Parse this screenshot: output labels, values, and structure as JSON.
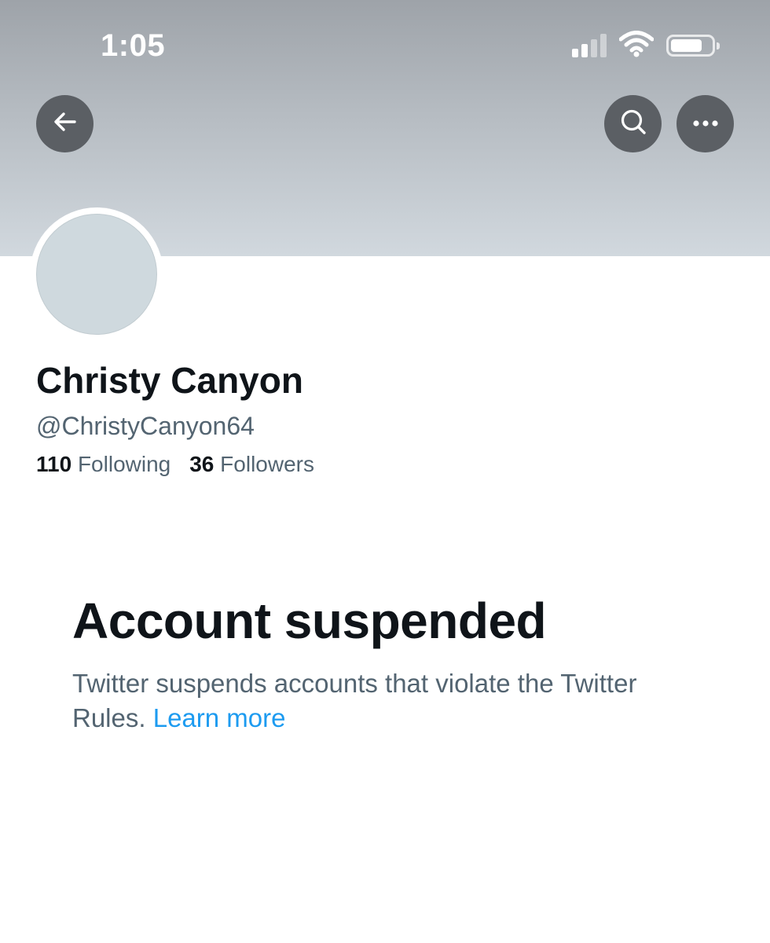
{
  "status_bar": {
    "time": "1:05",
    "signal_icon": "cellular-signal-icon",
    "wifi_icon": "wifi-icon",
    "battery_icon": "battery-icon"
  },
  "nav": {
    "back_icon": "arrow-left-icon",
    "search_icon": "search-icon",
    "more_icon": "more-horizontal-icon"
  },
  "profile": {
    "display_name": "Christy Canyon",
    "handle": "@ChristyCanyon64",
    "following_count": "110",
    "following_label": "Following",
    "followers_count": "36",
    "followers_label": "Followers"
  },
  "suspension": {
    "title": "Account suspended",
    "description": "Twitter suspends accounts that violate the Twitter Rules.",
    "link_text": "Learn more"
  },
  "colors": {
    "link": "#1d9bf0",
    "primary_text": "#0f1419",
    "secondary_text": "#536471",
    "avatar_placeholder": "#cfd9de"
  }
}
